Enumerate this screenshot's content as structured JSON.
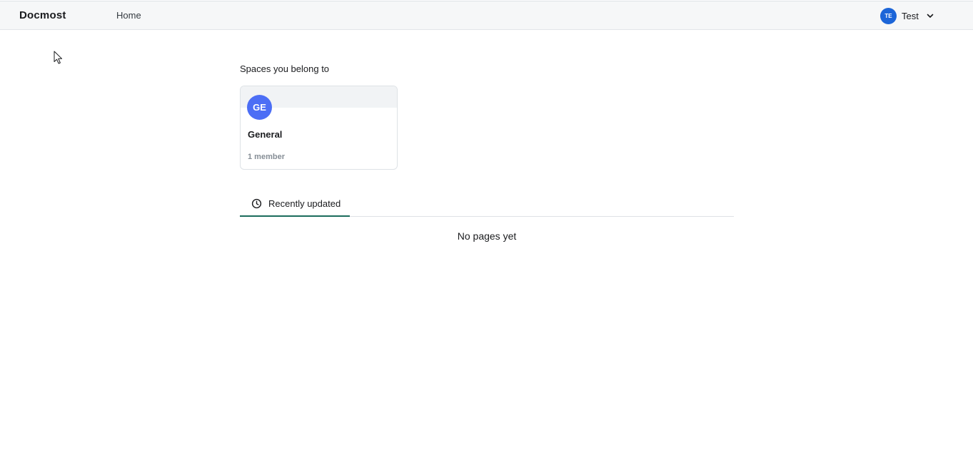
{
  "header": {
    "brand": "Docmost",
    "nav": {
      "home_label": "Home"
    },
    "user": {
      "initials": "TE",
      "name": "Test",
      "avatar_color": "#1c65d8",
      "chevron_icon": "chevron-down-icon"
    }
  },
  "spaces": {
    "title": "Spaces you belong to",
    "items": [
      {
        "initials": "GE",
        "name": "General",
        "members": "1 member",
        "avatar_color": "#4c6ef5"
      }
    ]
  },
  "tabs": {
    "items": [
      {
        "label": "Recently updated",
        "icon": "clock-icon",
        "active": true
      }
    ],
    "empty_text": "No pages yet"
  },
  "colors": {
    "accent_tab_underline": "#1b6c5c",
    "header_bg": "#f6f7f8"
  }
}
